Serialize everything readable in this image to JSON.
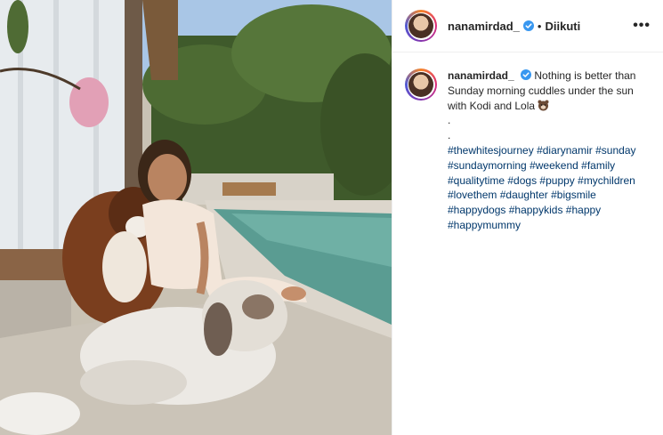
{
  "post": {
    "username": "nanamirdad_",
    "follow_status": "Diikuti",
    "separator": "•",
    "more_label": "•••",
    "caption_text": "Nothing is better than Sunday morning cuddles under the sun with Kodi and Lola",
    "dot1": ".",
    "dot2": ".",
    "hashtags": [
      "#thewhitesjourney",
      "#diarynamir",
      "#sunday",
      "#sundaymorning",
      "#weekend",
      "#family",
      "#qualitytime",
      "#dogs",
      "#puppy",
      "#mychildren",
      "#lovethem",
      "#daughter",
      "#bigsmile",
      "#happydogs",
      "#happykids",
      "#happy",
      "#happymummy"
    ]
  },
  "icons": {
    "verified": "verified-badge-icon",
    "more": "more-options-icon",
    "emoji": "bear-emoji-icon"
  },
  "colors": {
    "text": "#262626",
    "hashtag": "#00376b",
    "verified": "#3897f0",
    "divider": "#efefef"
  }
}
